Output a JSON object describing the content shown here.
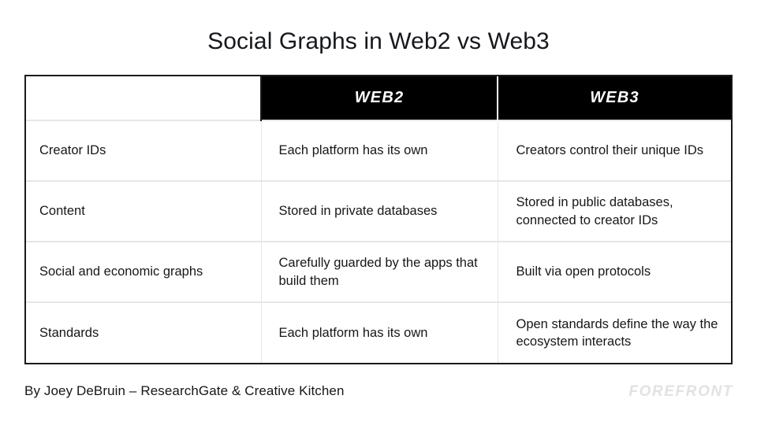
{
  "slide": {
    "title": "Social Graphs in Web2 vs Web3",
    "background_color": "#ffffff",
    "text_color": "#15171a"
  },
  "table": {
    "header_background": "#000000",
    "header_text_color": "#ffffff",
    "border_color": "#1a1a1a",
    "divider_color": "#e6e6e6",
    "columns": [
      {
        "key": "label",
        "label": ""
      },
      {
        "key": "web2",
        "label": "WEB2"
      },
      {
        "key": "web3",
        "label": "WEB3"
      }
    ],
    "rows": [
      {
        "label": "Creator IDs",
        "web2": "Each platform has its own",
        "web3": "Creators control their unique IDs"
      },
      {
        "label": "Content",
        "web2": "Stored in private databases",
        "web3": "Stored in public databases, connected to creator IDs"
      },
      {
        "label": "Social and economic graphs",
        "web2": "Carefully guarded by the apps that build them",
        "web3": "Built via open protocols"
      },
      {
        "label": "Standards",
        "web2": "Each platform has its own",
        "web3": "Open standards define the way the ecosystem interacts"
      }
    ]
  },
  "footer": {
    "credit": "By Joey DeBruin – ResearchGate & Creative Kitchen",
    "logo_text": "FOREFRONT",
    "logo_color": "#e2e2e2"
  }
}
